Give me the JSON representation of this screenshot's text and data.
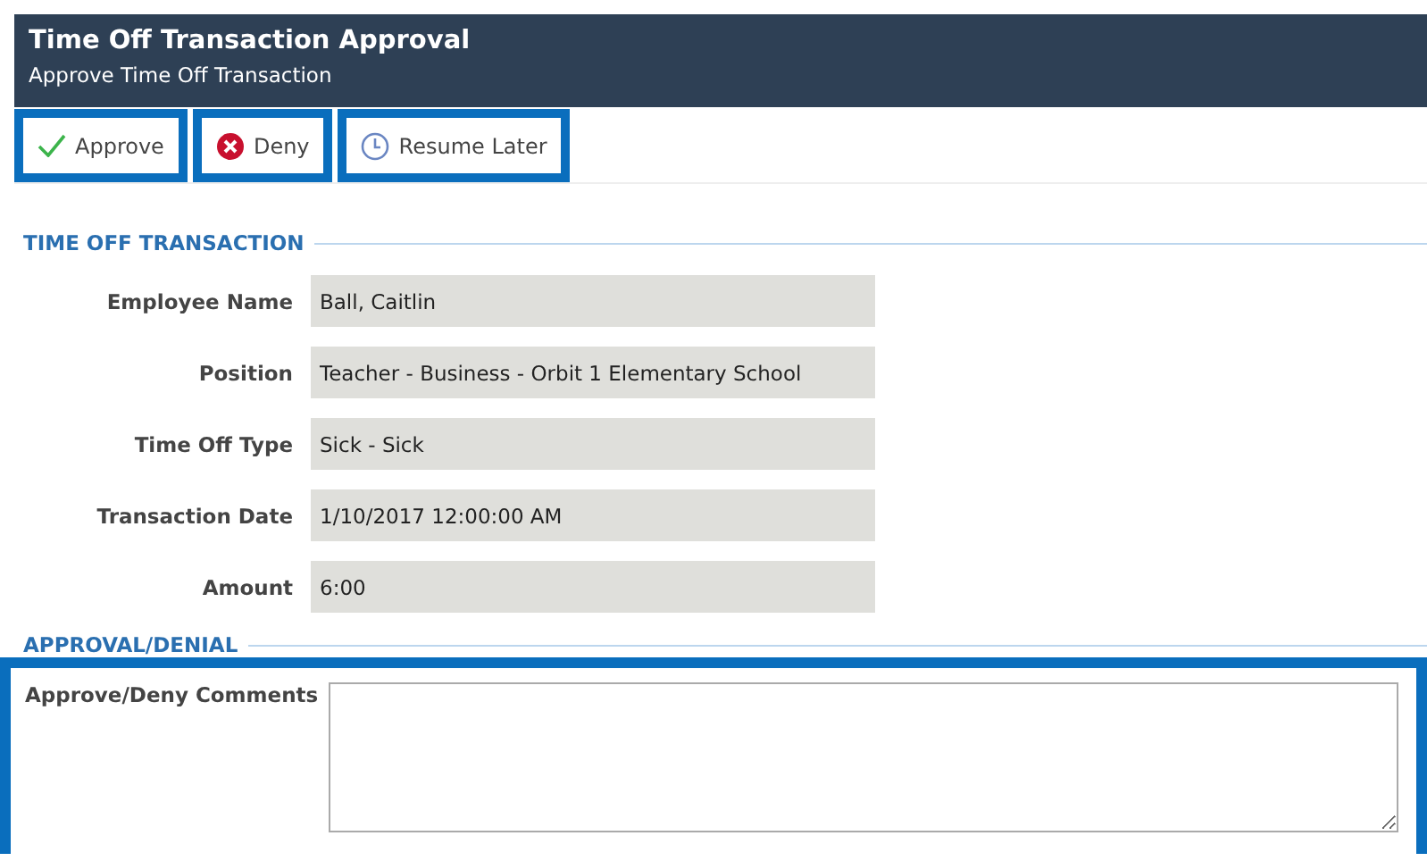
{
  "header": {
    "title": "Time Off Transaction Approval",
    "subtitle": "Approve Time Off Transaction"
  },
  "toolbar": [
    {
      "label": "Approve",
      "kind": "approve",
      "highlighted": true
    },
    {
      "label": "Deny",
      "kind": "deny",
      "highlighted": true
    },
    {
      "label": "Resume Later",
      "kind": "resume",
      "highlighted": true
    }
  ],
  "transaction": {
    "heading": "TIME OFF TRANSACTION",
    "fields": [
      {
        "label": "Employee Name",
        "value": "Ball, Caitlin"
      },
      {
        "label": "Position",
        "value": "Teacher - Business - Orbit 1 Elementary School"
      },
      {
        "label": "Time Off Type",
        "value": "Sick - Sick"
      },
      {
        "label": "Transaction Date",
        "value": "1/10/2017 12:00:00 AM"
      },
      {
        "label": "Amount",
        "value": "6:00"
      }
    ]
  },
  "approval": {
    "heading": "APPROVAL/DENIAL",
    "highlighted": true,
    "comments_label": "Approve/Deny Comments"
  }
}
